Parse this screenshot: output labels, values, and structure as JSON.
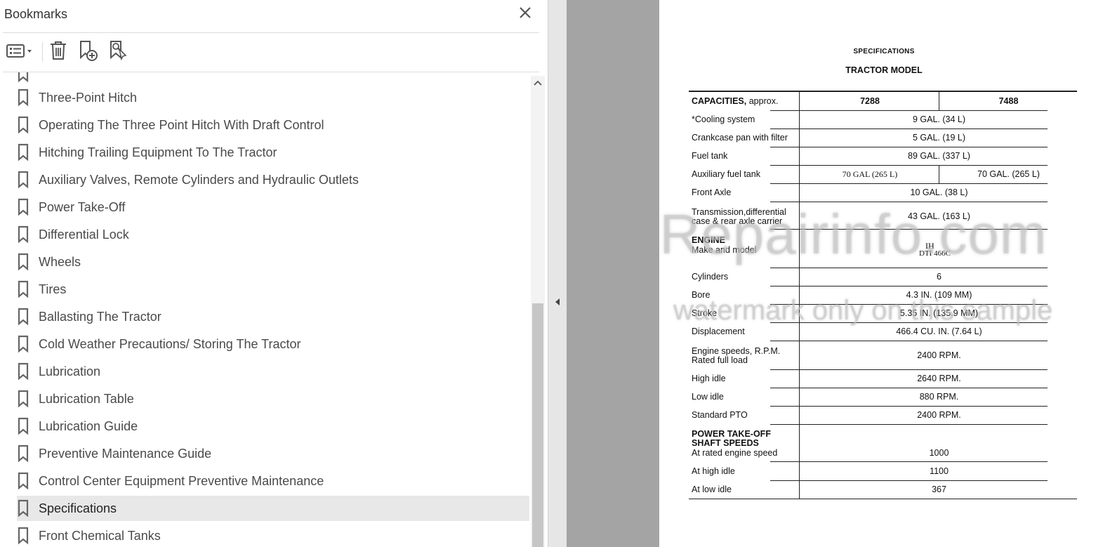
{
  "panel": {
    "title": "Bookmarks",
    "close_icon": "close-icon",
    "toolbar": {
      "options_icon": "list-options-icon",
      "delete_icon": "trash-icon",
      "new_bookmark_icon": "add-bookmark-icon",
      "find_bookmark_icon": "find-current-bookmark-icon"
    },
    "items": [
      {
        "label": "Three-Point Hitch"
      },
      {
        "label": "Operating The Three Point Hitch With Draft Control"
      },
      {
        "label": "Hitching Trailing Equipment To The Tractor"
      },
      {
        "label": "Auxiliary Valves, Remote Cylinders and Hydraulic Outlets"
      },
      {
        "label": "Power Take-Off"
      },
      {
        "label": "Differential Lock"
      },
      {
        "label": "Wheels"
      },
      {
        "label": "Tires"
      },
      {
        "label": "Ballasting The Tractor"
      },
      {
        "label": "Cold Weather Precautions/ Storing The Tractor"
      },
      {
        "label": "Lubrication"
      },
      {
        "label": "Lubrication Table"
      },
      {
        "label": "Lubrication Guide"
      },
      {
        "label": "Preventive Maintenance Guide"
      },
      {
        "label": "Control Center Equipment Preventive Maintenance"
      },
      {
        "label": "Specifications",
        "selected": true
      },
      {
        "label": "Front Chemical Tanks"
      }
    ],
    "selected_color": "#e8e8e8"
  },
  "document": {
    "title": "SPECIFICATIONS",
    "subtitle": "TRACTOR MODEL",
    "header": {
      "label_bold": "CAPACITIES,",
      "label_rest": " approx.",
      "model1": "7288",
      "model2": "7488"
    },
    "rows": {
      "cooling": {
        "label": "*Cooling system",
        "value": "9 GAL. (34 L)"
      },
      "crankcase": {
        "label": "Crankcase pan with filter",
        "value": "5 GAL. (19 L)"
      },
      "fuel": {
        "label": "Fuel tank",
        "value": "89 GAL. (337 L)"
      },
      "aux_fuel": {
        "label": "Auxiliary fuel tank",
        "value1": "70 GAL (265 L)",
        "value2": "70 GAL. (265 L)"
      },
      "front_axle": {
        "label": "Front Axle",
        "value": "10 GAL. (38 L)"
      },
      "transmission": {
        "label1": "Transmission,differential",
        "label2": "case & rear axle carrier",
        "value": "43 GAL. (163 L)"
      },
      "engine": {
        "heading": "ENGINE",
        "label": "Make and model",
        "value1": "IH",
        "value2": "DTI 466C"
      },
      "cylinders": {
        "label": "Cylinders",
        "value": "6"
      },
      "bore": {
        "label": "Bore",
        "value": "4.3 IN. (109 MM)"
      },
      "stroke": {
        "label": "Stroke",
        "value": "5.35 IN. (135.9 MM)"
      },
      "displacement": {
        "label": "Displacement",
        "value": "466.4 CU. IN. (7.64 L)"
      },
      "engine_speeds": {
        "label1": "Engine speeds, R.P.M.",
        "label2": "Rated full load",
        "value": "2400 RPM."
      },
      "high_idle": {
        "label": "High idle",
        "value": "2640 RPM."
      },
      "low_idle": {
        "label": "Low idle",
        "value": "880 RPM."
      },
      "std_pto": {
        "label": "Standard PTO",
        "value": "2400 RPM."
      },
      "pto": {
        "heading1": "POWER TAKE-OFF",
        "heading2": "SHAFT SPEEDS",
        "label": "At rated engine speed",
        "value": "1000"
      },
      "pto_high": {
        "label": "At high idle",
        "value": "1100"
      },
      "pto_low": {
        "label": "At low idle",
        "value": "367"
      }
    },
    "watermark1": "eRepairinfo.com",
    "watermark2": "watermark only on this sample"
  }
}
